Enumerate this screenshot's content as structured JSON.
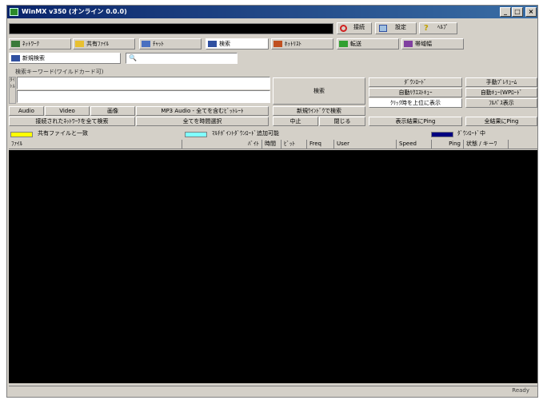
{
  "window": {
    "title": "WinMX v350 (オンライン 0.0.0)",
    "minimize": "_",
    "maximize": "□",
    "close": "×"
  },
  "status_input": {
    "value": ""
  },
  "top_buttons": {
    "disconnect": "接続",
    "settings": "設定",
    "help": "ﾍﾙﾌﾟ"
  },
  "tabs": [
    {
      "label": "ﾈｯﾄﾜｰｸ",
      "icon": "network-icon",
      "color": "#3a7a3a"
    },
    {
      "label": "共有ﾌｧｲﾙ",
      "icon": "folder-icon",
      "color": "#e8c030"
    },
    {
      "label": "ﾁｬｯﾄ",
      "icon": "chat-icon",
      "color": "#4a70c0"
    },
    {
      "label": "検索",
      "icon": "search-icon",
      "color": "#3050a0"
    },
    {
      "label": "ﾎｯﾄﾘｽﾄ",
      "icon": "hotlist-icon",
      "color": "#c05020"
    },
    {
      "label": "転送",
      "icon": "transfer-icon",
      "color": "#30a030"
    },
    {
      "label": "帯域幅",
      "icon": "bandwidth-icon",
      "color": "#8040a0"
    }
  ],
  "subtab": {
    "label": "新規検索"
  },
  "search_box": {
    "value": ""
  },
  "keywords_label": "検索キーワード(ワイルドカード可)",
  "side_label": "ﾀｲﾄﾙ",
  "search_inputs": {
    "line1": "",
    "line2": ""
  },
  "search_button": "検索",
  "right_buttons": {
    "download": "ﾀﾞｳﾝﾛｰﾄﾞ",
    "auto_requeue": "自動ﾘｸｴｽﾄｷｭｰ",
    "manual_queue": "手動ﾌﾟﾚﾘｭｰﾑ",
    "auto_queue_on": "自動ｷｭｰ(WPﾛｰﾄﾞ",
    "show_top": "ｸﾘｯｸ時を上位に表示",
    "full_view": "ﾌﾙﾊﾟｽ表示",
    "show_ping": "表示結果にPing",
    "all_ping": "全結果にPing"
  },
  "filter_buttons": {
    "audio": "Audio",
    "video": "Video",
    "image": "画像",
    "mp3_filter": "MP3 Audio - 全てを含むﾋﾞｯﾄﾚｰﾄ",
    "new_window": "新規ｳｲﾝﾄﾞｳで検索",
    "search_all_networks": "接続されたﾈｯﾄﾜｰｸを全て検索",
    "all_same": "全てを時間選択",
    "stop": "中止",
    "close": "閉じる"
  },
  "legend": {
    "shared": {
      "label": "共有ファイルと一致",
      "color": "#ffff00"
    },
    "multi": {
      "label": "ﾏﾙﾁﾎﾟｲﾝﾄﾀﾞｳﾝﾛｰﾄﾞ追加可能",
      "color": "#80ffff"
    },
    "downloading": {
      "label": "ﾀﾞｳﾝﾛｰﾄﾞ中",
      "color": "#000080"
    }
  },
  "columns": [
    "ﾌｧｲﾙ",
    "ﾊﾞｲﾄ",
    "時間",
    "ﾋﾞｯﾄ",
    "Freq",
    "User",
    "Speed",
    "Ping",
    "状態 / キーﾜ"
  ],
  "statusbar": {
    "text": "Ready"
  }
}
